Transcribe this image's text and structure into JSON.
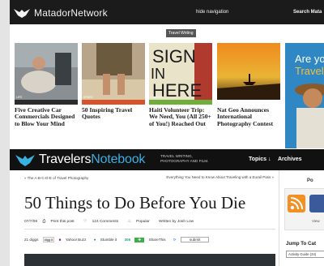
{
  "matador": {
    "brand": "MatadorNetwork",
    "hide_nav": "hide navigation",
    "search": "Search Mata"
  },
  "tab_label": "Travel Writing",
  "cards": [
    {
      "tag": "Life",
      "title": "Five Creative Car Commercials Designed to Blow Your Mind",
      "strip_color": "#2b2b2b"
    },
    {
      "tag": "Sport",
      "title": "50 Inspiring Travel Quotes",
      "strip_color": "#d8522b"
    },
    {
      "tag": "Change",
      "title": "Haiti Volunteer Trip: We Need, You (All 250+ of You!) Reached Out",
      "strip_color": "#6fae3a"
    },
    {
      "tag": "",
      "title": "Nat Geo Announces International Photography Contest",
      "strip_color": "#ffffff"
    }
  ],
  "promo": {
    "line1": "Are yo",
    "line2": "Travel"
  },
  "travelers_notebook": {
    "name_part1": "Travelers",
    "name_part2": "Notebook",
    "tagline": "TRAVEL WRITING, PHOTOGRAPHY AND FILM.",
    "topics": "Topics ↓",
    "archives": "Archives"
  },
  "article": {
    "prev_link": "« The A-B-C-D-E of Travel Photography",
    "next_link": "Everything You Need to Know About Traveling with a Eurail Pass »",
    "title": "50 Things to Do Before You Die",
    "date": "07/7/08",
    "print": "Print this post",
    "comments": "124 Comments",
    "popular": "Popular",
    "author": "Written by Josh Low",
    "share": {
      "diggs": "21 diggs",
      "digg_it": "digg it",
      "yahoo": "Yahoo! Buzz",
      "stumble": "Stumble it",
      "count": "306",
      "share_this": "ShareThis",
      "submit": "submit"
    }
  },
  "sidebar": {
    "heading": "Po",
    "view": "View",
    "jump": "Jump To Cat",
    "select": "Activity Guide (34)"
  }
}
